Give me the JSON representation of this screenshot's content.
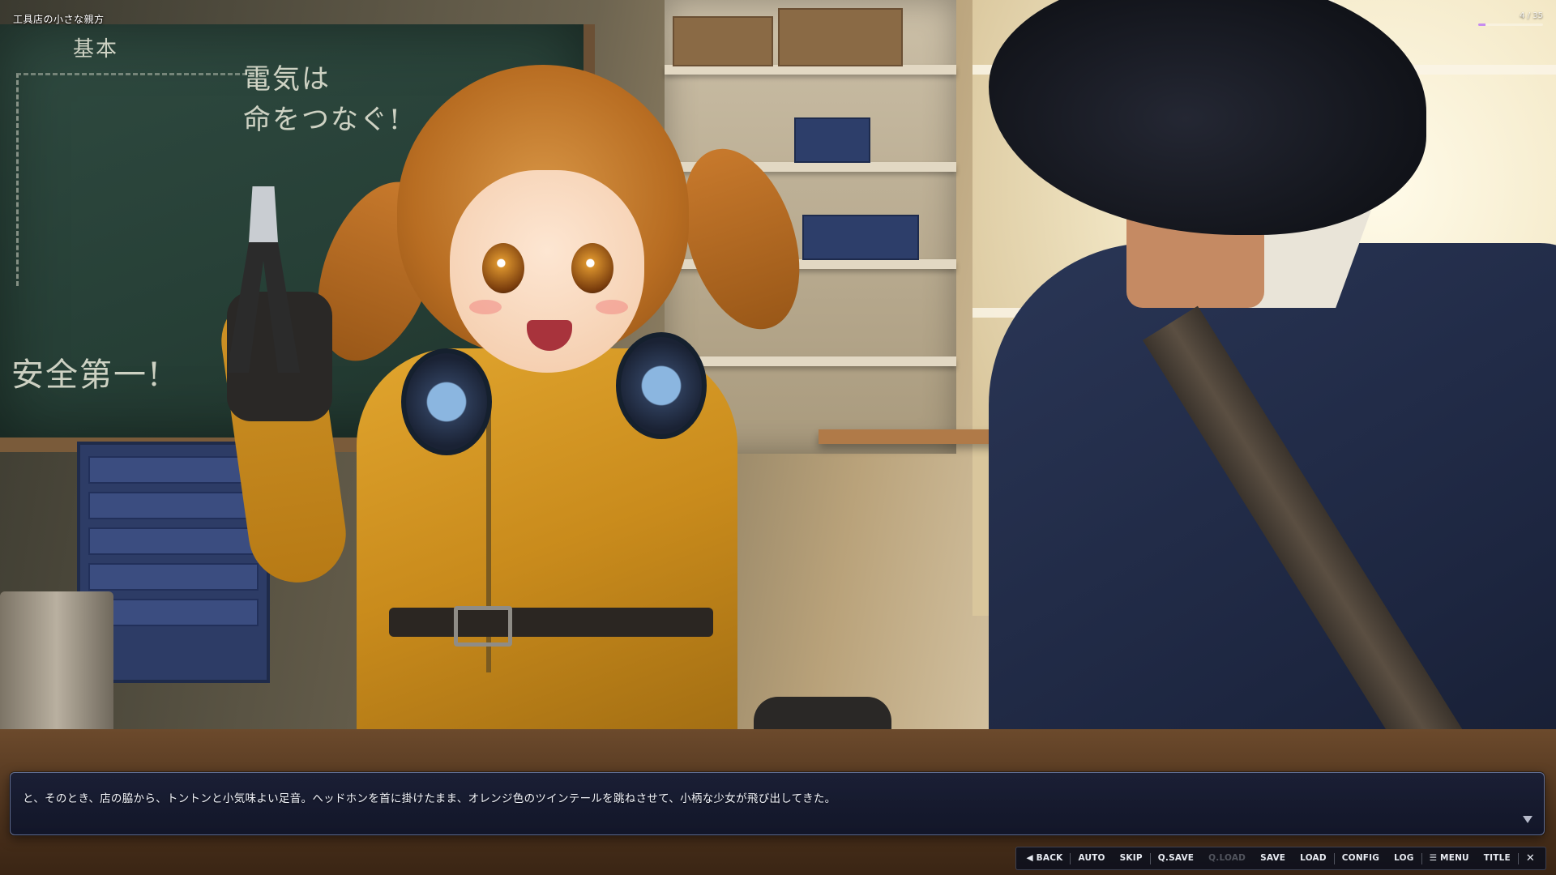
{
  "game": {
    "title": "工具店の小さな親方"
  },
  "progress": {
    "current": 4,
    "total": 35,
    "label": "4 / 35",
    "fraction": 0.114,
    "color": "#c78cf0"
  },
  "scene": {
    "chalkboard_text": [
      "電気は",
      "命をつなぐ!",
      "安全第一!",
      "基本"
    ]
  },
  "dialogue": {
    "text": "と、そのとき、店の脇から、トントンと小気味よい足音。ヘッドホンを首に掛けたまま、オレンジ色のツインテールを跳ねさせて、小柄な少女が飛び出してきた。",
    "advance_icon": "triangle-down-icon"
  },
  "menu": {
    "back": "◀ BACK",
    "auto": "AUTO",
    "skip": "SKIP",
    "qsave": "Q.SAVE",
    "qload": "Q.LOAD",
    "save": "SAVE",
    "load": "LOAD",
    "config": "CONFIG",
    "log": "LOG",
    "menu": "☰ MENU",
    "title": "TITLE",
    "close": "✕"
  }
}
